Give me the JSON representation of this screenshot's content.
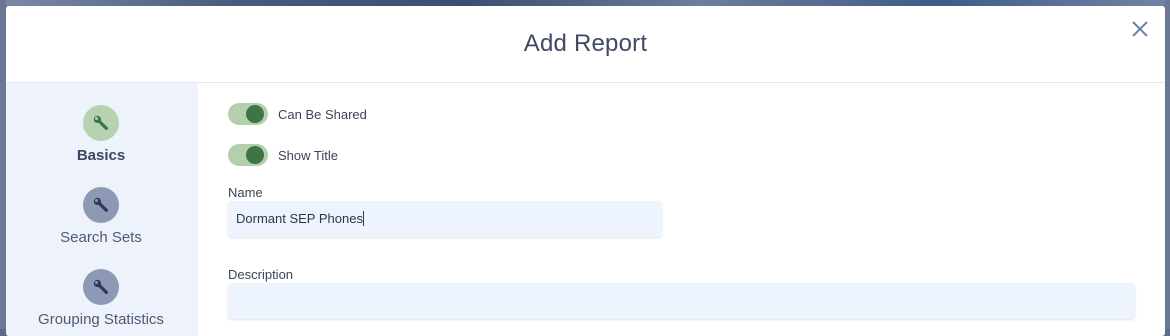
{
  "modal": {
    "title": "Add Report"
  },
  "sidebar": {
    "steps": [
      {
        "label": "Basics",
        "icon": "wrench-icon",
        "active": true
      },
      {
        "label": "Search Sets",
        "icon": "wrench-icon",
        "active": false
      },
      {
        "label": "Grouping Statistics",
        "icon": "wrench-icon",
        "active": false
      }
    ]
  },
  "form": {
    "toggles": [
      {
        "label": "Can Be Shared",
        "on": true
      },
      {
        "label": "Show Title",
        "on": true
      }
    ],
    "name": {
      "label": "Name",
      "value": "Dormant SEP Phones"
    },
    "description": {
      "label": "Description",
      "value": ""
    }
  },
  "colors": {
    "toggle_on_track": "#b3cfad",
    "toggle_on_knob": "#3e7545",
    "active_step": "#b7d2b0",
    "inactive_step": "#8e99b5",
    "title_text": "#3e4a66"
  }
}
